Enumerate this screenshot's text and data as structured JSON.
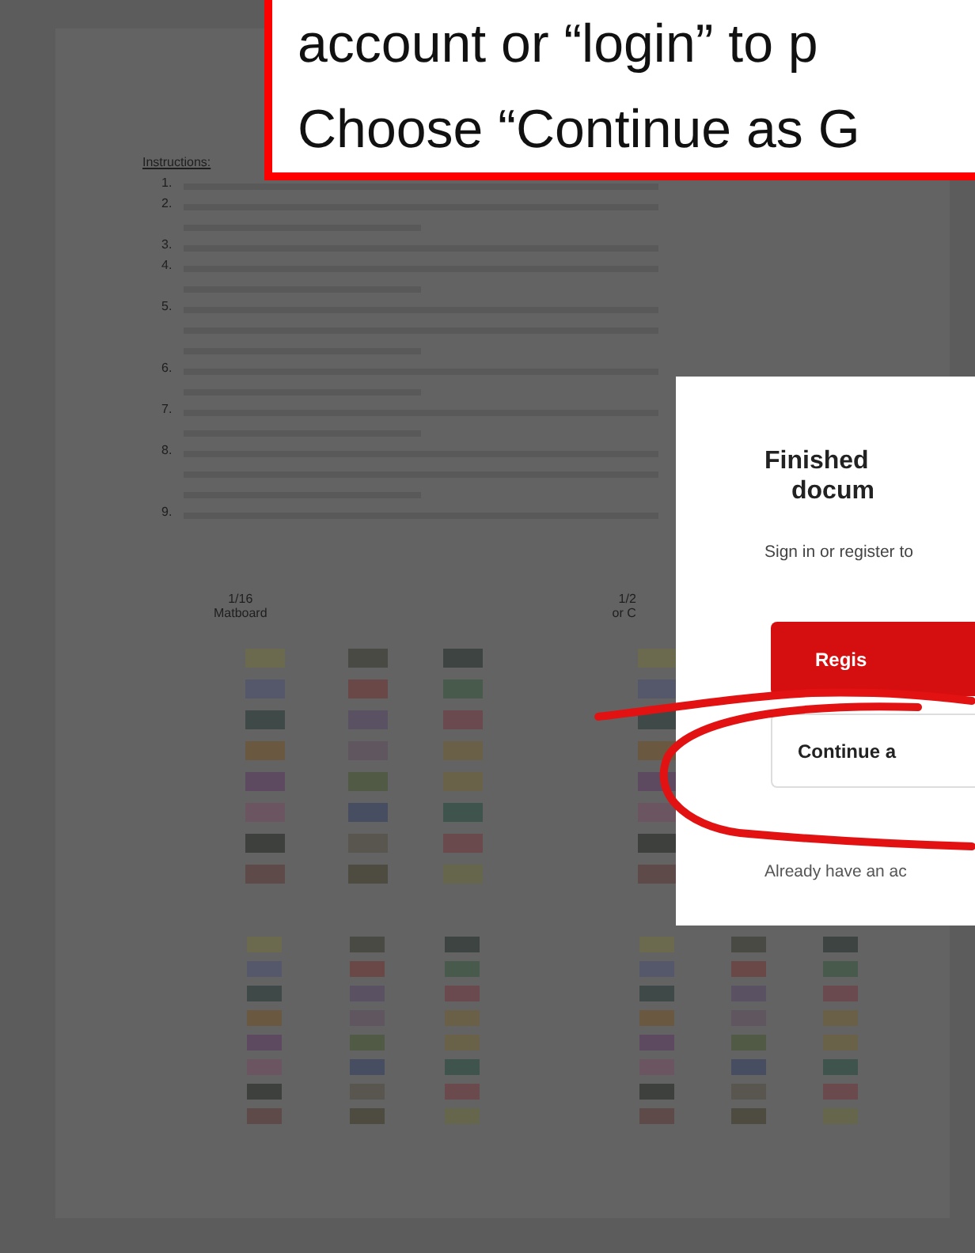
{
  "document": {
    "heading": "Instructions:",
    "steps": [
      {
        "number": "1."
      },
      {
        "number": "2."
      },
      {
        "number": "3."
      },
      {
        "number": "4."
      },
      {
        "number": "5."
      },
      {
        "number": "6."
      },
      {
        "number": "7."
      },
      {
        "number": "8."
      },
      {
        "number": "9."
      }
    ],
    "column_labels": [
      {
        "lines": [
          "1/16",
          "Matboard"
        ]
      },
      {
        "lines": [
          "1/2",
          "or C"
        ]
      }
    ]
  },
  "annotation": {
    "lines": [
      "account or “login” to p",
      "Choose “Continue as G"
    ]
  },
  "modal": {
    "title": [
      "Finished",
      "docum"
    ],
    "subtitle": "Sign in or register to",
    "buttons": [
      {
        "label": "Regis",
        "kind": "primary"
      },
      {
        "label": "Continue a",
        "kind": "secondary"
      }
    ],
    "footer": "Already have an ac"
  }
}
